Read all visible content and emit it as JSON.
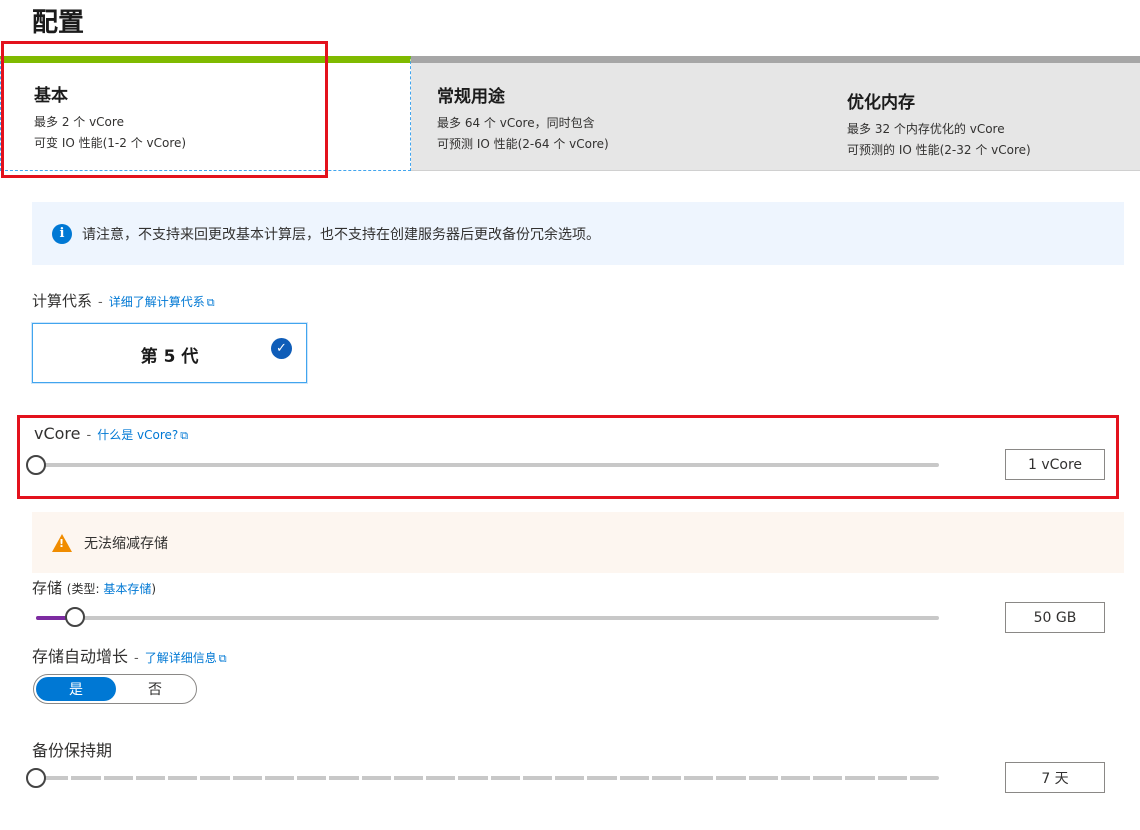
{
  "page": {
    "title": "配置"
  },
  "tiers": [
    {
      "name": "基本",
      "line1": "最多 2 个 vCore",
      "line2": "可变 IO 性能(1-2 个 vCore)",
      "selected": true
    },
    {
      "name": "常规用途",
      "line1": "最多 64 个 vCore，同时包含",
      "line2": "可预测 IO 性能(2-64 个 vCore)",
      "selected": false
    },
    {
      "name": "优化内存",
      "line1": "最多 32 个内存优化的 vCore",
      "line2": "可预测的 IO 性能(2-32 个 vCore)",
      "selected": false
    }
  ],
  "info": {
    "icon": "info-icon",
    "text": "请注意，不支持来回更改基本计算层，也不支持在创建服务器后更改备份冗余选项。"
  },
  "compute_gen": {
    "label": "计算代系",
    "separator": "-",
    "link": "详细了解计算代系",
    "option": "第 5 代",
    "selected": true
  },
  "vcore": {
    "label": "vCore",
    "separator": "-",
    "link": "什么是 vCore?",
    "value": "1 vCore",
    "slider_fraction": 0
  },
  "warning": {
    "icon": "warning-icon",
    "text": "无法缩减存储"
  },
  "storage": {
    "label": "存储",
    "type_prefix": "(类型: ",
    "type_link": "基本存储",
    "type_suffix": ")",
    "value": "50 GB",
    "slider_fraction": 0.043
  },
  "auto_grow": {
    "label": "存储自动增长",
    "separator": "-",
    "link": "了解详细信息",
    "yes": "是",
    "no": "否",
    "selected": "是"
  },
  "backup": {
    "label": "备份保持期",
    "value": "7 天",
    "slider_fraction": 0
  },
  "colors": {
    "accent": "#0078d4",
    "selected_tier_bar": "#7fba00",
    "highlight": "#e3121d",
    "storage_fill": "#7d2ba1"
  }
}
